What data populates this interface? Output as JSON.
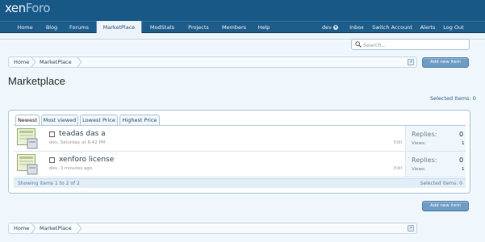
{
  "header": {
    "logo_main": "xen",
    "logo_accent": "Foro"
  },
  "nav": {
    "items": [
      "Home",
      "Blog",
      "Forums",
      "MarketPlace",
      "ModStats",
      "Projects",
      "Members",
      "Help"
    ],
    "selected": "MarketPlace",
    "right": {
      "user": "dev",
      "inbox": "Inbox",
      "switch_account": "Switch Account",
      "alerts": "Alerts",
      "logout": "Log Out"
    }
  },
  "search": {
    "placeholder": "Search..."
  },
  "breadcrumb": [
    "Home",
    "MarketPlace"
  ],
  "buttons": {
    "add_new_item": "Add new item"
  },
  "page": {
    "title": "Marketplace",
    "selected_items": "Selected Items: 0"
  },
  "tabs": [
    "Newest",
    "Most viewed",
    "Lowest Price",
    "Highest Price"
  ],
  "active_tab": "Newest",
  "items": [
    {
      "title": "teadas das a",
      "author": "dev",
      "date": ", Saturday at 6:42 PM",
      "edit": "Edit",
      "replies_label": "Replies:",
      "replies": "0",
      "views_label": "Views:",
      "views": "1"
    },
    {
      "title": "xenforo license",
      "author": "dev",
      "date": ", 3 minutes ago",
      "edit": "Edit",
      "replies_label": "Replies:",
      "replies": "0",
      "views_label": "Views:",
      "views": "1"
    }
  ],
  "list_footer": {
    "showing": "Showing items 1 to 2 of 2",
    "selected": "Selected items: 0"
  },
  "colors": {
    "header_bg": "#185886",
    "nav_bg": "#1e5c8a",
    "page_bg": "#f0f7fc",
    "button_bg": "#6f9cc4"
  }
}
